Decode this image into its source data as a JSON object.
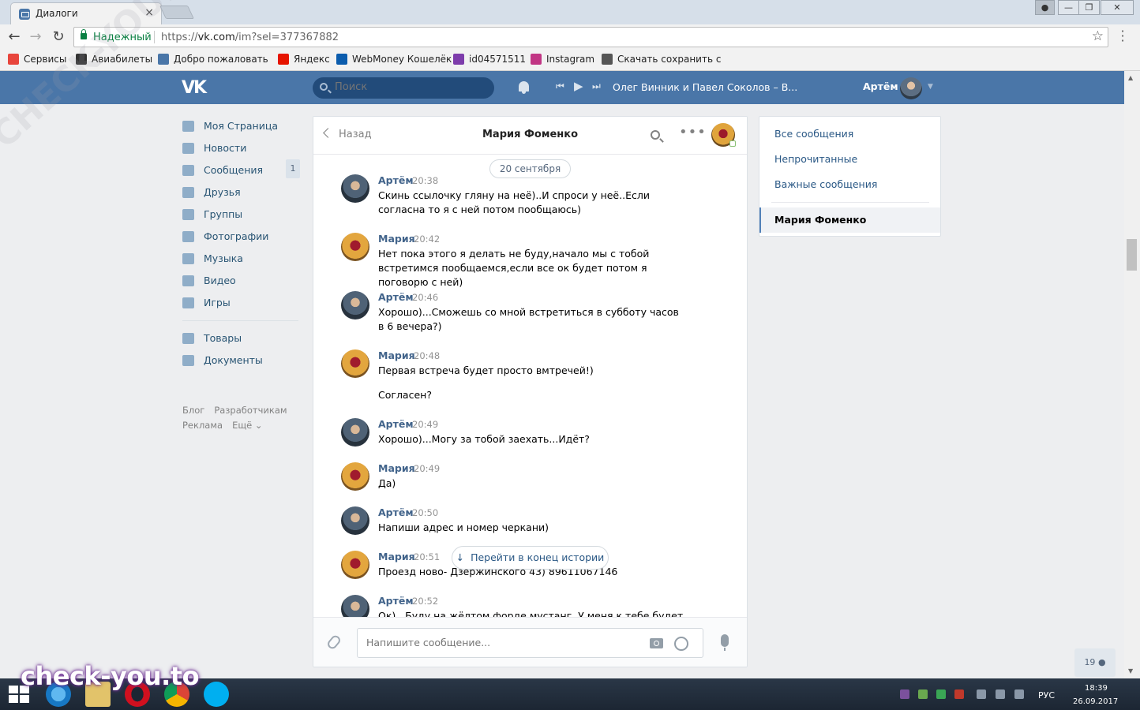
{
  "browser": {
    "tab_title": "Диалоги",
    "tab_close": "×",
    "secure_label": "Надежный",
    "url_prefix": "https://",
    "url_host": "vk.com",
    "url_path": "/im?sel=377367882",
    "window_controls": {
      "minimize": "—",
      "maximize": "❐",
      "close": "✕"
    },
    "bookmarks": [
      {
        "label": "Сервисы",
        "icon": "apps-grid-icon",
        "color": "#e8453c"
      },
      {
        "label": "Авиабилеты",
        "icon": "airplane-icon",
        "color": "#333333"
      },
      {
        "label": "Добро пожаловать",
        "icon": "vk-icon",
        "color": "#4a76a8"
      },
      {
        "label": "Яндекс",
        "icon": "yandex-icon",
        "color": "#e61400"
      },
      {
        "label": "WebMoney Кошелёк",
        "icon": "webmoney-icon",
        "color": "#0b5cad"
      },
      {
        "label": "id04571511",
        "icon": "s-logo-icon",
        "color": "#7d3cab"
      },
      {
        "label": "Instagram",
        "icon": "instagram-icon",
        "color": "#c13584"
      },
      {
        "label": "Скачать сохранить с",
        "icon": "download-icon",
        "color": "#555555"
      }
    ]
  },
  "vk": {
    "search_placeholder": "Поиск",
    "player": {
      "prev": "⏮",
      "play": "▶",
      "next": "⏭",
      "track": "Олег Винник и Павел Соколов – В..."
    },
    "user_name": "Артём",
    "accent_color": "#4a76a8",
    "left_menu": [
      {
        "label": "Моя Страница",
        "icon": "home-icon"
      },
      {
        "label": "Новости",
        "icon": "news-icon"
      },
      {
        "label": "Сообщения",
        "icon": "messages-icon",
        "badge": "1"
      },
      {
        "label": "Друзья",
        "icon": "friends-icon"
      },
      {
        "label": "Группы",
        "icon": "groups-icon"
      },
      {
        "label": "Фотографии",
        "icon": "camera-icon"
      },
      {
        "label": "Музыка",
        "icon": "music-icon"
      },
      {
        "label": "Видео",
        "icon": "video-icon"
      },
      {
        "label": "Игры",
        "icon": "games-icon"
      }
    ],
    "left_menu_extra": [
      {
        "label": "Товары",
        "icon": "bag-icon"
      },
      {
        "label": "Документы",
        "icon": "document-icon"
      }
    ],
    "footer_links": [
      "Блог",
      "Разработчикам",
      "Реклама",
      "Ещё ⌄"
    ]
  },
  "chat": {
    "back_label": "Назад",
    "title": "Мария Фоменко",
    "more": "•••",
    "date_divider": "20 сентября",
    "messages": [
      {
        "author": "Артём",
        "time": "20:38",
        "text": "Скинь ссылочку гляну на неё)..И спроси у неё..Если согласна то я с ней потом пообщаюсь)"
      },
      {
        "author": "Мария",
        "time": "20:42",
        "text": "Нет пока этого я делать не буду,начало мы с тобой встретимся пообщаемся,если все ок будет потом я поговорю с ней)"
      },
      {
        "author": "Артём",
        "time": "20:46",
        "text": "Хорошо)...Сможешь со мной встретиться в субботу часов в 6 вечера?)"
      },
      {
        "author": "Мария",
        "time": "20:48",
        "text": "Первая встреча будет просто вмтречей!)",
        "text2": "Согласен?"
      },
      {
        "author": "Артём",
        "time": "20:49",
        "text": "Хорошо)...Могу за тобой заехать...Идёт?"
      },
      {
        "author": "Мария",
        "time": "20:49",
        "text": "Да)"
      },
      {
        "author": "Артём",
        "time": "20:50",
        "text": "Напиши адрес и номер черкани)"
      },
      {
        "author": "Мария",
        "time": "20:51",
        "text": "Проезд ново- Дзержинского 43) 89611067146"
      },
      {
        "author": "Артём",
        "time": "20:52",
        "text": "Ок)...Буду на жёлтом форде мустанг..У меня к тебе будет ещё"
      }
    ],
    "goto_end": "Перейти в конец истории",
    "composer_placeholder": "Напишите сообщение..."
  },
  "filters": {
    "items": [
      "Все сообщения",
      "Непрочитанные",
      "Важные сообщения"
    ],
    "active": "Мария Фоменко"
  },
  "online_counter": "19",
  "taskbar": {
    "lang": "РУС",
    "time": "18:39",
    "date": "26.09.2017"
  },
  "watermark": "check-you.to",
  "diagonal_watermark": "CHECK-YOU.ME"
}
